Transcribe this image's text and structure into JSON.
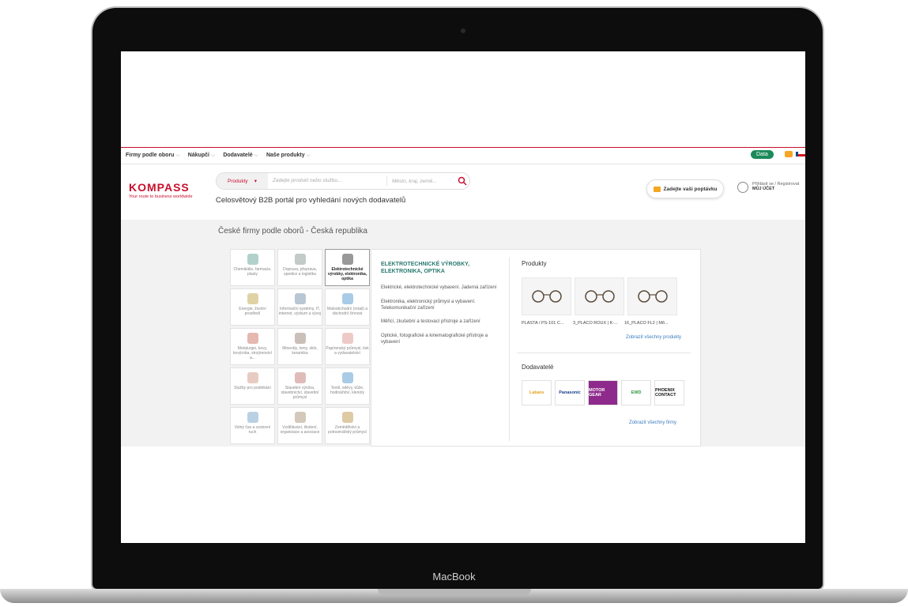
{
  "device": {
    "brand_label": "MacBook"
  },
  "topnav": {
    "items": [
      {
        "label": "Firmy podle oboru"
      },
      {
        "label": "Nákupčí"
      },
      {
        "label": "Dodavatelé"
      },
      {
        "label": "Naše produkty"
      }
    ],
    "data_badge": "Data"
  },
  "header": {
    "logo_text": "KOMPASS",
    "logo_tagline": "Your route to business worldwide",
    "search": {
      "category": "Produkty",
      "product_placeholder": "Zadejte produkt nebo službu...",
      "place_placeholder": "Město, kraj, země..."
    },
    "tagline": "Celosvětový B2B portál pro vyhledání nových dodavatelů",
    "quote_button": "Zadejte vaši poptávku",
    "account_login": "Přihlásit se / Registrovat",
    "account_label": "MŮJ ÚČET"
  },
  "main": {
    "section_title": "České firmy podle oborů - Česká republika",
    "categories": [
      {
        "label": "Chemikálie, farmacie, plasty",
        "color": "#7fb2a9"
      },
      {
        "label": "Doprava, přeprava, spedice a logistika",
        "color": "#9aa9a1"
      },
      {
        "label": "Elektrotechnické výrobky, elektronika, optika",
        "color": "#555555"
      },
      {
        "label": "Energie, životní prostředí",
        "color": "#c9b56a"
      },
      {
        "label": "Informační systémy, IT, internet, výzkum a vývoj",
        "color": "#8aa1b8"
      },
      {
        "label": "Maloobchodní (retail) a obchodní činnost",
        "color": "#6fa8d6"
      },
      {
        "label": "Metalurgie, kovy, kovýroba, strojírenství a...",
        "color": "#d4897b"
      },
      {
        "label": "Minerály, lomy, sklo, keramika",
        "color": "#a8948a"
      },
      {
        "label": "Papírenský průmysl, tisk a vydavatelství",
        "color": "#e3a6a0"
      },
      {
        "label": "Služby pro podnikání",
        "color": "#d9a99a"
      },
      {
        "label": "Stavební výroba, stavebnictví, stavební průmysl",
        "color": "#cc8f8a"
      },
      {
        "label": "Textil, oděvy, kůže, hodinářství, klenoty",
        "color": "#6fa8d6"
      },
      {
        "label": "Volný čas a cestovní ruch",
        "color": "#8ab3d1"
      },
      {
        "label": "Vzdělávání, školení, organizace a asociace",
        "color": "#b8a48c"
      },
      {
        "label": "Zemědělství a potravinářský průmysl",
        "color": "#c9a66b"
      }
    ],
    "detail": {
      "title": "ELEKTROTECHNICKÉ VÝROBKY, ELEKTRONIKA, OPTIKA",
      "links": [
        "Elektrické, elektrotechnické vybavení. Jaderná zařízení",
        "Elektronika, elektronický průmysl a vybavení. Telekomunikační zařízení",
        "Měřicí, zkušební a testovací přístroje a zařízení",
        "Optické, fotografické a kinematografické přístroje a vybavení"
      ],
      "products_heading": "Produkty",
      "products": [
        {
          "name": "PLASTA / PS-101 C..."
        },
        {
          "name": "3_PLACO ROUX | K-..."
        },
        {
          "name": "16_PLACO FL2 | Mő..."
        }
      ],
      "all_products_link": "Zobrazit všechny produkty",
      "suppliers_heading": "Dodavatelé",
      "suppliers": [
        {
          "name": "Labara",
          "color": "#e6a020",
          "bg": "#ffffff"
        },
        {
          "name": "Panasonic",
          "color": "#1a3e8c",
          "bg": "#ffffff"
        },
        {
          "name": "MOTOR GEAR",
          "color": "#ffffff",
          "bg": "#8e2a8c"
        },
        {
          "name": "EWD",
          "color": "#2f9a3a",
          "bg": "#ffffff"
        },
        {
          "name": "PHOENIX CONTACT",
          "color": "#111111",
          "bg": "#ffffff"
        }
      ],
      "all_suppliers_link": "Zobrazit všechny firmy"
    }
  }
}
